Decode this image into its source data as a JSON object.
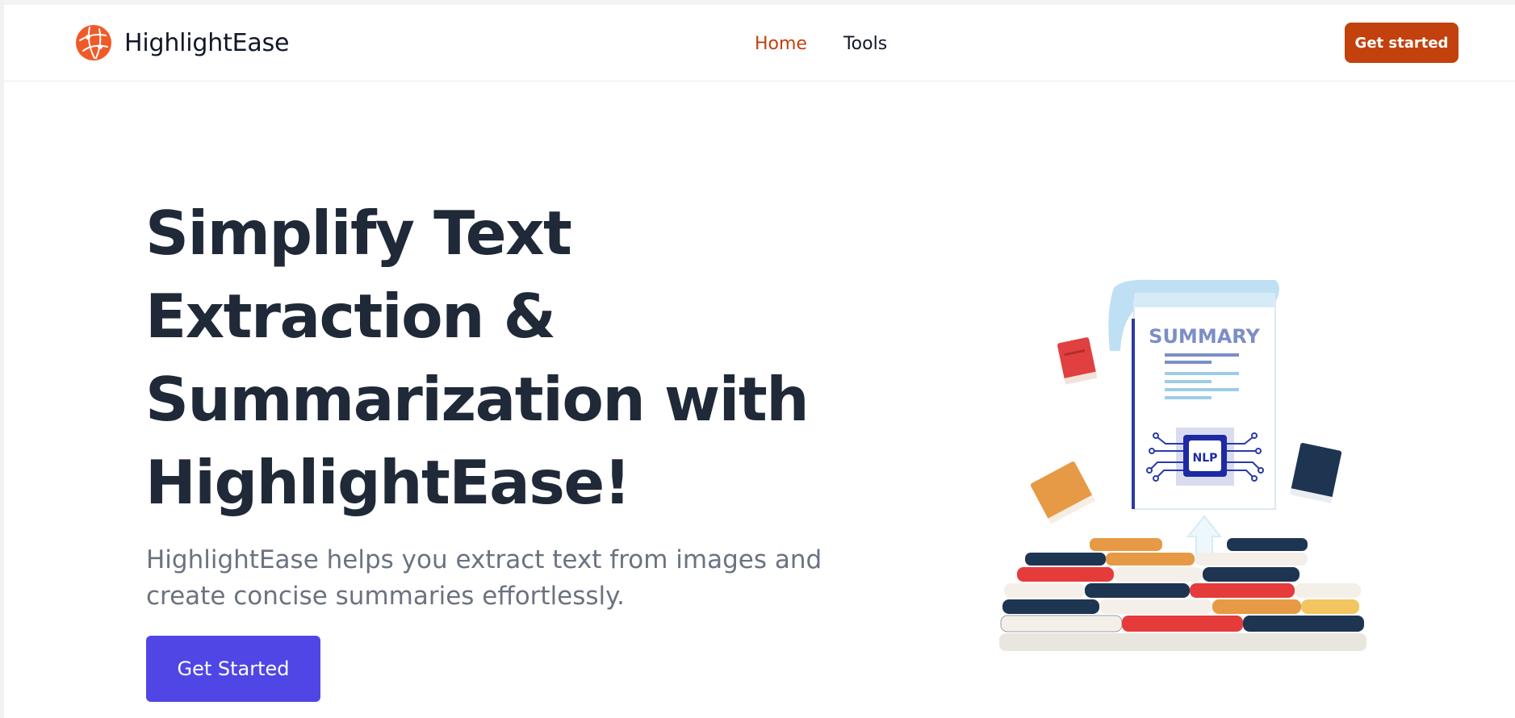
{
  "navbar": {
    "brand_name": "HighlightEase",
    "links": [
      {
        "label": "Home",
        "active": true
      },
      {
        "label": "Tools",
        "active": false
      }
    ],
    "cta_label": "Get started"
  },
  "hero": {
    "title_lines": [
      "Simplify Text",
      "Extraction &",
      "Summarization with",
      "HighlightEase!"
    ],
    "subtitle_lines": [
      "HighlightEase helps you extract text from images and",
      "create concise summaries effortlessly."
    ],
    "cta_label": "Get Started"
  },
  "illustration": {
    "document_heading": "SUMMARY",
    "chip_label": "NLP"
  },
  "colors": {
    "accent_orange": "#c2410c",
    "accent_indigo": "#4f46e5",
    "heading": "#1f2937",
    "subtext": "#6b7280"
  },
  "icons": {
    "brand_logo": "globe-network-icon",
    "upload_arrow": "up-arrow-icon"
  }
}
